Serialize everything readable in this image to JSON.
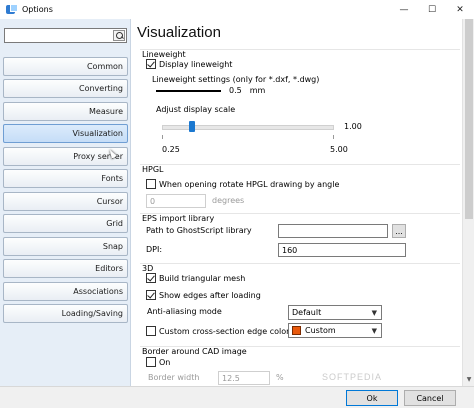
{
  "window": {
    "title": "Options",
    "minimize": "—",
    "maximize": "☐",
    "close": "✕"
  },
  "search": {
    "placeholder": "",
    "value": ""
  },
  "sidebar": {
    "items": [
      {
        "label": "Common"
      },
      {
        "label": "Converting"
      },
      {
        "label": "Measure"
      },
      {
        "label": "Visualization"
      },
      {
        "label": "Proxy server"
      },
      {
        "label": "Fonts"
      },
      {
        "label": "Cursor"
      },
      {
        "label": "Grid"
      },
      {
        "label": "Snap"
      },
      {
        "label": "Editors"
      },
      {
        "label": "Associations"
      },
      {
        "label": "Loading/Saving"
      }
    ],
    "active": "Visualization"
  },
  "main": {
    "title": "Visualization",
    "lineweight": {
      "header": "Lineweight",
      "display_label": "Display lineweight",
      "display_checked": true,
      "settings_label": "Lineweight settings (only for *.dxf, *.dwg)",
      "value": "0.5",
      "unit": "mm",
      "scale_label": "Adjust display scale",
      "scale_value": "1.00",
      "scale_min": "0.25",
      "scale_max": "5.00",
      "scale_level": 0.16
    },
    "hpgl": {
      "header": "HPGL",
      "rotate_label": "When opening rotate HPGL drawing by angle",
      "rotate_checked": false,
      "angle_value": "0",
      "angle_unit": "degrees"
    },
    "eps": {
      "header": "EPS import library",
      "path_label": "Path to GhostScript library",
      "path_value": "",
      "browse_label": "...",
      "dpi_label": "DPI:",
      "dpi_value": "160"
    },
    "three_d": {
      "header": "3D",
      "build_mesh_label": "Build triangular mesh",
      "build_mesh_checked": true,
      "show_edges_label": "Show edges after loading",
      "show_edges_checked": true,
      "antialiasing_label": "Anti-aliasing mode",
      "antialiasing_value": "Default",
      "custom_edge_label": "Custom cross-section edge color",
      "custom_edge_checked": false,
      "edge_color_value": "Custom",
      "edge_color": "#e8590c"
    },
    "border": {
      "header": "Border around CAD image",
      "on_label": "On",
      "on_checked": false,
      "width_label": "Border width",
      "width_value": "12.5",
      "width_unit": "%"
    }
  },
  "buttons": {
    "ok": "Ok",
    "cancel": "Cancel"
  },
  "watermark": "SOFTPEDIA"
}
